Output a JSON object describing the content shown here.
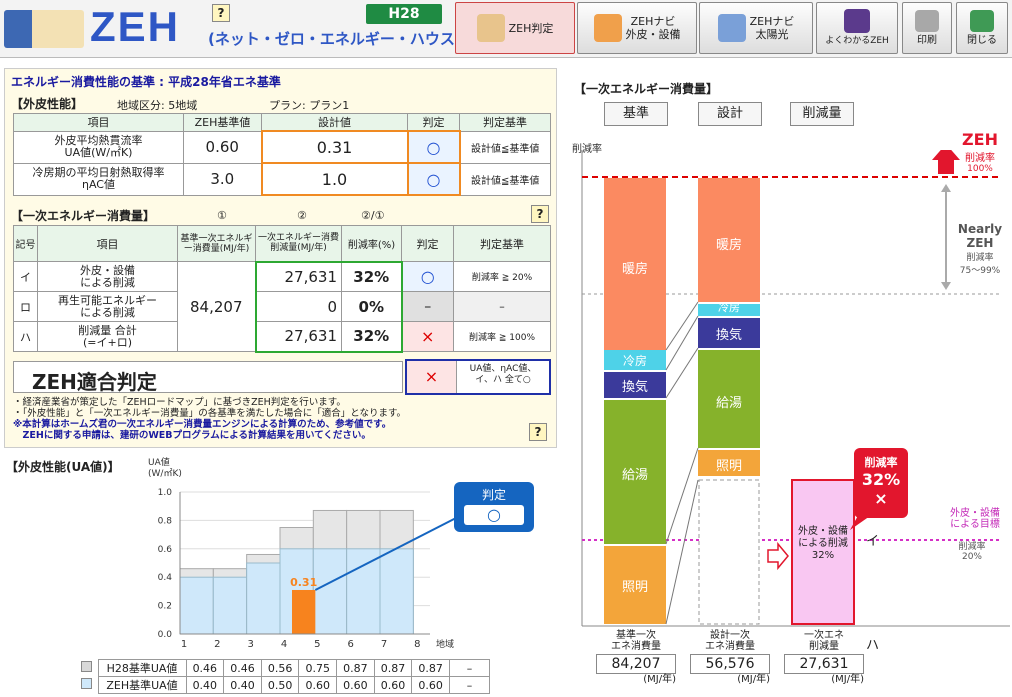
{
  "header": {
    "logo_text": "ZEH",
    "subtitle": "(ネット・ゼロ・エネルギー・ハウス)",
    "badge": "H28",
    "help_label": "?",
    "tabs": [
      {
        "label": "ZEH判定"
      },
      {
        "label1": "ZEHナビ",
        "label2": "外皮・設備"
      },
      {
        "label1": "ZEHナビ",
        "label2": "太陽光"
      }
    ],
    "tools": [
      {
        "label": "よくわかるZEH"
      },
      {
        "label": "印刷"
      },
      {
        "label": "閉じる"
      }
    ]
  },
  "left": {
    "title": "エネルギー消費性能の基準 : 平成28年省エネ基準",
    "envelope": {
      "heading": "【外皮性能】",
      "region": "地域区分: 5地域",
      "plan": "プラン: プラン1",
      "cols": [
        "項目",
        "ZEH基準値",
        "設計値",
        "判定",
        "判定基準"
      ],
      "rows": [
        {
          "item1": "外皮平均熱貫流率",
          "item2": "UA値(W/㎡K)",
          "std": "0.60",
          "design": "0.31",
          "judge": "○",
          "rule": "設計値≦基準値"
        },
        {
          "item1": "冷房期の平均日射熱取得率",
          "item2": "ηAC値",
          "std": "3.0",
          "design": "1.0",
          "judge": "○",
          "rule": "設計値≦基準値"
        }
      ]
    },
    "energy": {
      "heading": "【一次エネルギー消費量】",
      "n1": "①",
      "n2": "②",
      "n3": "②/①",
      "cols": [
        "記号",
        "項目",
        "基準一次エネルギー消費量(MJ/年)",
        "一次エネルギー消費 削減量(MJ/年)",
        "削減率(%)",
        "判定",
        "判定基準"
      ],
      "base": "84,207",
      "rows": [
        {
          "sym": "イ",
          "item1": "外皮・設備",
          "item2": "による削減",
          "red": "27,631",
          "rate": "32%",
          "judge": "○",
          "rule": "削減率 ≧ 20%"
        },
        {
          "sym": "ロ",
          "item1": "再生可能エネルギー",
          "item2": "による削減",
          "red": "0",
          "rate": "0%",
          "judge": "–",
          "rule": "–"
        },
        {
          "sym": "ハ",
          "item1": "削減量 合計",
          "item2": "(=イ+ロ)",
          "red": "27,631",
          "rate": "32%",
          "judge": "×",
          "rule": "削減率 ≧ 100%"
        }
      ]
    },
    "verdict": {
      "label": "ZEH適合判定",
      "mark": "×",
      "rule": "UA値、ηAC値、イ、ハ 全て○"
    },
    "notes": [
      "・経済産業省が策定した「ZEHロードマップ」に基づきZEH判定を行います。",
      "・「外皮性能」と「一次エネルギー消費量」の各基準を満たした場合に「適合」となります。",
      "※本計算はホームズ君の一次エネルギー消費量エンジンによる計算のため、参考値です。",
      "　ZEHに関する申請は、建研のWEBプログラムによる計算結果を用いてください。"
    ]
  },
  "ua_chart": {
    "heading": "【外皮性能(UA値)】",
    "ylabel1": "UA値",
    "ylabel2": "(W/㎡K)",
    "xunit": "地域",
    "yticks": [
      "1.0",
      "0.8",
      "0.6",
      "0.4",
      "0.2",
      "0.0"
    ],
    "judge_title": "判定",
    "judge_mark": "○",
    "value_label": "0.31",
    "legend": [
      {
        "name": "H28基準UA値"
      },
      {
        "name": "ZEH基準UA値"
      }
    ],
    "dash": "–"
  },
  "chart_data": {
    "type": "bar",
    "categories": [
      "1",
      "2",
      "3",
      "4",
      "5",
      "6",
      "7",
      "8"
    ],
    "series": [
      {
        "name": "H28基準UA値",
        "values": [
          0.46,
          0.46,
          0.56,
          0.75,
          0.87,
          0.87,
          0.87,
          null
        ],
        "labels": [
          "0.46",
          "0.46",
          "0.56",
          "0.75",
          "0.87",
          "0.87",
          "0.87",
          "–"
        ]
      },
      {
        "name": "ZEH基準UA値",
        "values": [
          0.4,
          0.4,
          0.5,
          0.6,
          0.6,
          0.6,
          0.6,
          null
        ],
        "labels": [
          "0.40",
          "0.40",
          "0.50",
          "0.60",
          "0.60",
          "0.60",
          "0.60",
          "–"
        ]
      }
    ],
    "design_value": {
      "region": "5",
      "value": 0.31
    },
    "ylim": [
      0,
      1.0
    ]
  },
  "right": {
    "title": "【一次エネルギー消費量】",
    "buttons": [
      "基準",
      "設計",
      "削減量"
    ],
    "ylabel": "削減率",
    "zeh": "ZEH",
    "zeh_sub": "削減率",
    "zeh_pct": "100%",
    "nearly": "Nearly",
    "nearly2": "ZEH",
    "nearly_sub": "削減率",
    "nearly_pct": "75～99%",
    "std_segs": [
      "暖房",
      "冷房",
      "換気",
      "給湯",
      "照明"
    ],
    "des_segs": [
      "暖房",
      "冷房",
      "換気",
      "給湯",
      "照明"
    ],
    "red_box": [
      "外皮・設備",
      "による削減",
      "32%"
    ],
    "callout": [
      "削減率",
      "32%",
      "×"
    ],
    "target": [
      "外皮・設備",
      "による目標"
    ],
    "target_rate": "削減率",
    "target_pct": "20%",
    "i_mark": "イ",
    "ha_mark": "ハ",
    "foot": [
      {
        "l1": "基準一次",
        "l2": "エネ消費量",
        "val": "84,207",
        "unit": "(MJ/年)"
      },
      {
        "l1": "設計一次",
        "l2": "エネ消費量",
        "val": "56,576",
        "unit": "(MJ/年)"
      },
      {
        "l1": "一次エネ",
        "l2": "削減量",
        "val": "27,631",
        "unit": "(MJ/年)"
      }
    ]
  },
  "colors": {
    "heating": "#fb8a61",
    "cooling": "#4ed2e8",
    "ventilation": "#3b3a9b",
    "hotwater": "#86b22b",
    "lighting": "#f3a53a"
  }
}
